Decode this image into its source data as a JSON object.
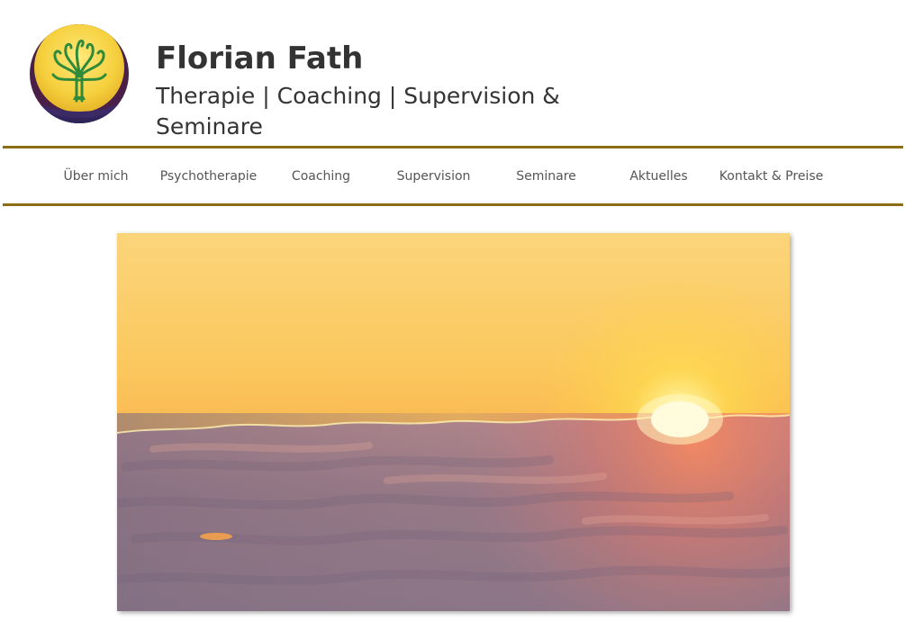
{
  "header": {
    "title": "Florian Fath",
    "tagline": "Therapie | Coaching | Supervision & Seminare",
    "logo_icon": "tree-logo-icon"
  },
  "nav": {
    "items": [
      {
        "label": "Über mich"
      },
      {
        "label": "Psychotherapie"
      },
      {
        "label": "Coaching"
      },
      {
        "label": "Supervision"
      },
      {
        "label": "Seminare"
      },
      {
        "label": "Aktuelles"
      },
      {
        "label": "Kontakt & Preise"
      }
    ]
  },
  "hero": {
    "subject": "sunrise-over-clouds"
  },
  "colors": {
    "accent_rule": "#8a6d14",
    "text": "#333333",
    "nav_text": "#555555"
  }
}
